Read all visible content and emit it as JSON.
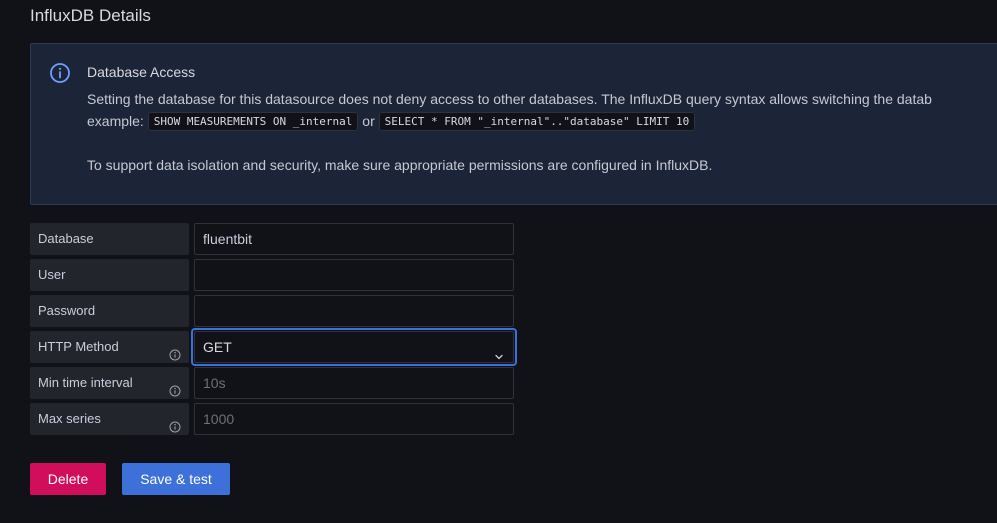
{
  "section": {
    "title": "InfluxDB Details"
  },
  "alert": {
    "icon": "info-circle-icon",
    "title": "Database Access",
    "line1": "Setting the database for this datasource does not deny access to other databases. The InfluxDB query syntax allows switching the datab",
    "example_prefix": "example:",
    "code1": "SHOW MEASUREMENTS ON _internal",
    "or_text": "or",
    "code2": "SELECT * FROM \"_internal\"..\"database\" LIMIT 10",
    "line3": "To support data isolation and security, make sure appropriate permissions are configured in InfluxDB."
  },
  "form": {
    "database": {
      "label": "Database",
      "value": "fluentbit"
    },
    "user": {
      "label": "User",
      "value": ""
    },
    "password": {
      "label": "Password",
      "value": ""
    },
    "http_method": {
      "label": "HTTP Method",
      "value": "GET"
    },
    "min_time_interval": {
      "label": "Min time interval",
      "placeholder": "10s"
    },
    "max_series": {
      "label": "Max series",
      "placeholder": "1000"
    }
  },
  "buttons": {
    "delete": "Delete",
    "save": "Save & test"
  },
  "colors": {
    "background": "#111217",
    "alert_bg": "#1c2537",
    "info_accent": "#6e9fff",
    "primary": "#3d71d9",
    "destructive": "#d10e5c"
  }
}
